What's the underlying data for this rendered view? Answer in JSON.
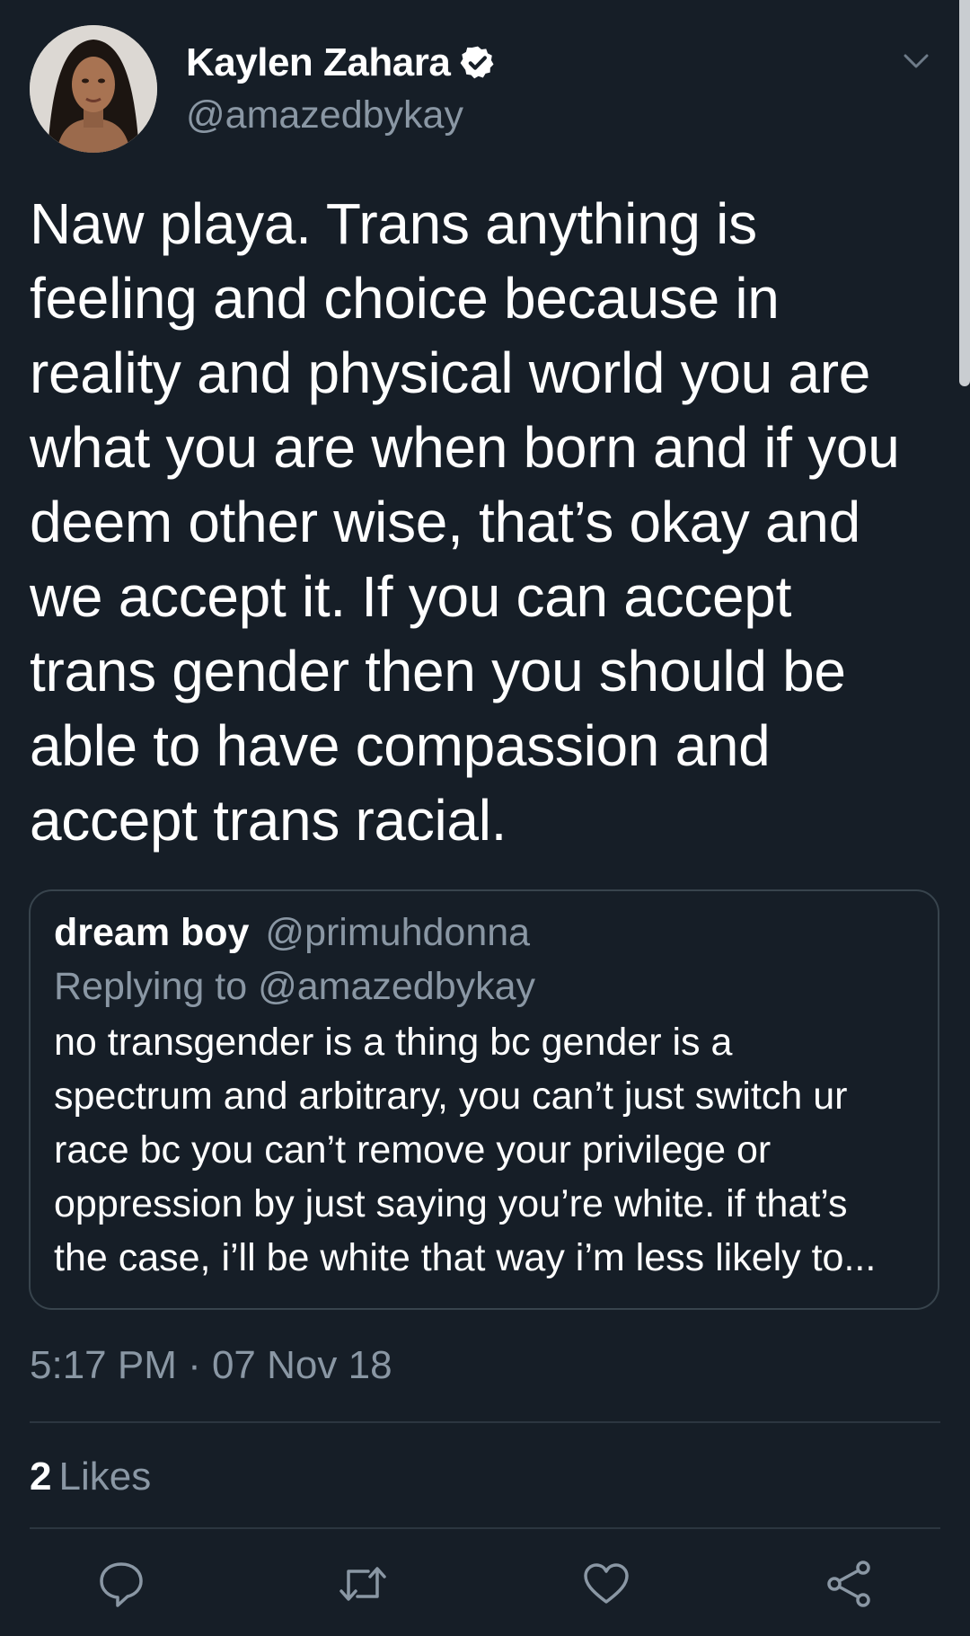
{
  "author": {
    "display_name": "Kaylen Zahara",
    "handle": "@amazedbykay",
    "verified_icon": "verified-badge-icon"
  },
  "tweet": {
    "lines": [
      "Naw playa. Trans anything is",
      "feeling and choice because in",
      "reality and physical world you are",
      "what you are when born and if you",
      "deem other wise, that’s okay and",
      "we accept it. If you can accept",
      "trans gender then you should be",
      "able to have compassion and",
      "accept trans racial."
    ],
    "timestamp": "5:17 PM · 07 Nov 18"
  },
  "quoted_tweet": {
    "display_name": "dream boy",
    "handle": "@primuhdonna",
    "replying_to": "Replying to @amazedbykay",
    "lines": [
      "no transgender is a thing bc gender is a",
      "spectrum and arbitrary, you can’t just switch ur",
      "race bc you can’t remove your privilege or",
      "oppression by just saying you’re white. if that’s",
      "the case, i’ll be white that way i’m less likely to..."
    ]
  },
  "stats": {
    "likes_count": "2",
    "likes_label": "Likes"
  },
  "actions": [
    "reply-icon",
    "retweet-icon",
    "like-icon",
    "share-icon"
  ],
  "colors": {
    "background": "#161e27",
    "secondary_text": "#8a97a4",
    "border": "#38444d"
  }
}
